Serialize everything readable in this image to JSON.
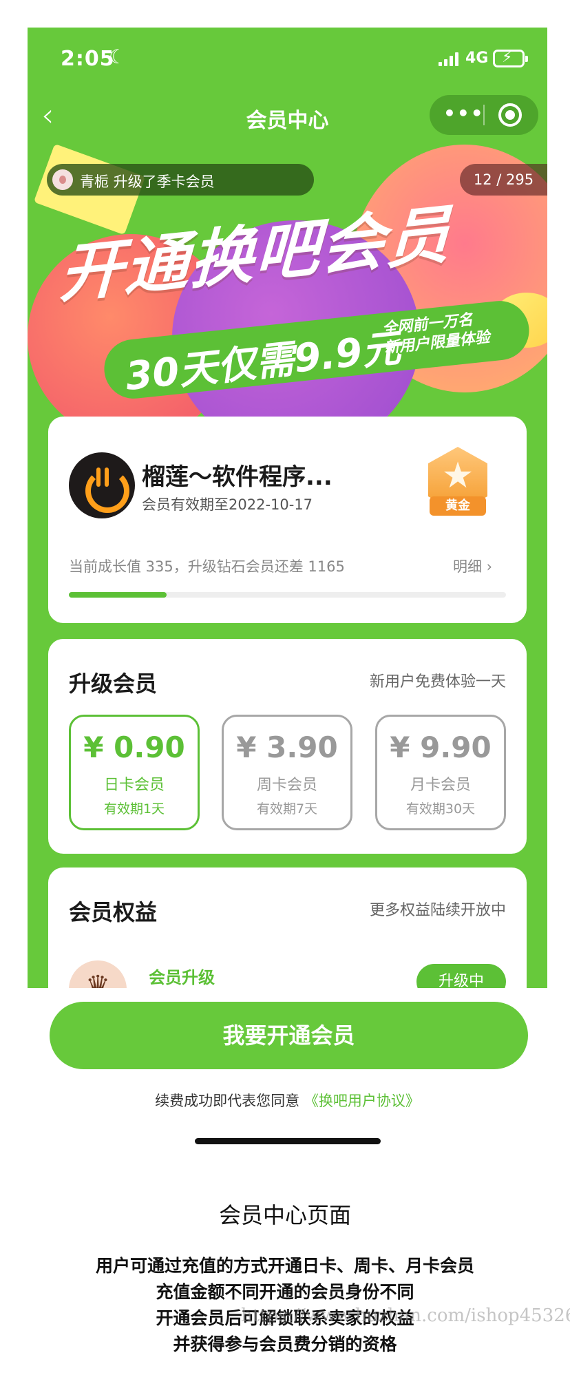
{
  "status_bar": {
    "time": "2:05",
    "network": "4G"
  },
  "nav": {
    "title": "会员中心",
    "back_glyph": "‹",
    "more_glyph": "•••"
  },
  "banner": {
    "notice_text": "青栀  升级了季卡会员",
    "counter": "12 / 295",
    "headline": "开通换吧会员",
    "promo_big": "30天仅需9.9元",
    "promo_small_line1": "全网前一万名",
    "promo_small_line2": "新用户限量体验"
  },
  "profile": {
    "name": "榴莲～软件程序...",
    "expire": "会员有效期至2022-10-17",
    "badge_label": "黄金",
    "growth_text": "当前成长值 335，升级钻石会员还差 1165",
    "growth_value": 335,
    "growth_target": 1500,
    "detail_label": "明细 ›"
  },
  "upgrade": {
    "title": "升级会员",
    "hint": "新用户免费体验一天",
    "plans": [
      {
        "price": "¥ 0.90",
        "name": "日卡会员",
        "valid": "有效期1天"
      },
      {
        "price": "¥ 3.90",
        "name": "周卡会员",
        "valid": "有效期7天"
      },
      {
        "price": "¥ 9.90",
        "name": "月卡会员",
        "valid": "有效期30天"
      }
    ]
  },
  "benefits": {
    "title": "会员权益",
    "hint": "更多权益陆续开放中",
    "item_name": "会员升级",
    "item_button": "升级中"
  },
  "footer": {
    "open_button": "我要开通会员",
    "agree_prefix": "续费成功即代表您同意",
    "agree_link": "《换吧用户协议》"
  },
  "caption": {
    "title": "会员中心页面",
    "lines": [
      "用户可通过充值的方式开通日卡、周卡、月卡会员",
      "充值金额不同开通的会员身份不同",
      "开通会员后可解锁联系卖家的权益",
      "并获得参与会员费分销的资格"
    ],
    "watermark": "https://www.huzhan.com/ishop45326"
  },
  "colors": {
    "brand_green": "#67c93b",
    "accent_green": "#5cc036",
    "badge_gold": "#f49a2a"
  }
}
